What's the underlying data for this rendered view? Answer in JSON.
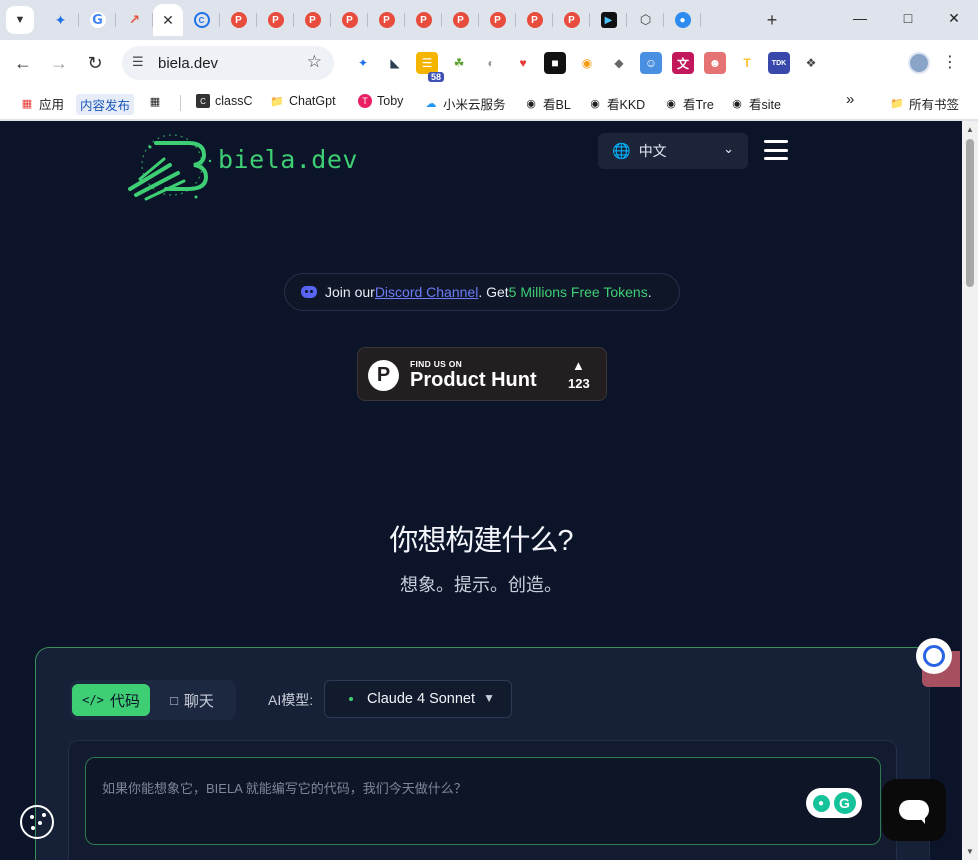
{
  "browser": {
    "tabs": [
      {
        "icon": "v-icon",
        "glyph": "✦",
        "cls": "v"
      },
      {
        "icon": "google-icon",
        "glyph": "G",
        "cls": "g"
      },
      {
        "icon": "trend-icon",
        "glyph": "↗",
        "cls": "trend"
      },
      {
        "icon": "close-icon",
        "glyph": "✕",
        "cls": "x",
        "active": true
      },
      {
        "icon": "c-icon",
        "glyph": "C",
        "cls": "c"
      },
      {
        "icon": "product-hunt-icon",
        "glyph": "P",
        "cls": "p"
      },
      {
        "icon": "product-hunt-icon",
        "glyph": "P",
        "cls": "p"
      },
      {
        "icon": "product-hunt-icon",
        "glyph": "P",
        "cls": "p"
      },
      {
        "icon": "product-hunt-icon",
        "glyph": "P",
        "cls": "p"
      },
      {
        "icon": "product-hunt-icon",
        "glyph": "P",
        "cls": "p"
      },
      {
        "icon": "product-hunt-icon",
        "glyph": "P",
        "cls": "p"
      },
      {
        "icon": "product-hunt-icon",
        "glyph": "P",
        "cls": "p"
      },
      {
        "icon": "product-hunt-icon",
        "glyph": "P",
        "cls": "p"
      },
      {
        "icon": "product-hunt-icon",
        "glyph": "P",
        "cls": "p"
      },
      {
        "icon": "product-hunt-icon",
        "glyph": "P",
        "cls": "p"
      },
      {
        "icon": "arrow-icon",
        "glyph": "▶",
        "cls": "arrow"
      },
      {
        "icon": "cube-icon",
        "glyph": "⬡",
        "cls": "cube"
      },
      {
        "icon": "globe-icon",
        "glyph": "●",
        "cls": "globe"
      }
    ],
    "url": "biela.dev",
    "extensions": [
      {
        "icon": "v-extension-icon",
        "bg": "#ffffff",
        "fg": "#1e73e8",
        "glyph": "✦"
      },
      {
        "icon": "reader-extension-icon",
        "bg": "#ffffff",
        "fg": "#2c3e50",
        "glyph": "◣"
      },
      {
        "icon": "58-extension-icon",
        "bg": "#f5b400",
        "fg": "#fff",
        "glyph": "☰",
        "badge": "58"
      },
      {
        "icon": "puzzle-green-extension-icon",
        "bg": "#ffffff",
        "fg": "#5aa02c",
        "glyph": "☘"
      },
      {
        "icon": "gray-circle-extension-icon",
        "bg": "#ffffff",
        "fg": "#999",
        "glyph": "◐"
      },
      {
        "icon": "red-extension-icon",
        "bg": "#ffffff",
        "fg": "#e53935",
        "glyph": "♥"
      },
      {
        "icon": "dark-extension-icon",
        "bg": "#111111",
        "fg": "#fff",
        "glyph": "■"
      },
      {
        "icon": "orange-extension-icon",
        "bg": "#ffffff",
        "fg": "#f39c12",
        "glyph": "◉"
      },
      {
        "icon": "diamond-extension-icon",
        "bg": "#ffffff",
        "fg": "#666",
        "glyph": "◆"
      },
      {
        "icon": "blue-chat-extension-icon",
        "bg": "#4a90e2",
        "fg": "#fff",
        "glyph": "☺"
      },
      {
        "icon": "translate-extension-icon",
        "bg": "#c2185b",
        "fg": "#fff",
        "glyph": "文"
      },
      {
        "icon": "face-extension-icon",
        "bg": "#e57373",
        "fg": "#fff",
        "glyph": "☻"
      },
      {
        "icon": "t-extension-icon",
        "bg": "#ffffff",
        "fg": "#fbc02d",
        "glyph": "T"
      },
      {
        "icon": "tdk-extension-icon",
        "bg": "#3949ab",
        "fg": "#fff",
        "glyph": "TDK"
      },
      {
        "icon": "puzzle-extension-icon",
        "bg": "#ffffff",
        "fg": "#444",
        "glyph": "❖"
      }
    ],
    "bookmarks": {
      "apps": "应用",
      "publish": "内容发布",
      "classc": "classC",
      "chatgpt": "ChatGpt",
      "toby": "Toby",
      "xiaomi": "小米云服务",
      "bl": "看BL",
      "kkd": "看KKD",
      "tre": "看Tre",
      "site": "看site",
      "more": "»",
      "all": "所有书签"
    }
  },
  "page": {
    "logo_text": "biela.dev",
    "language": "中文",
    "discord": {
      "prefix": "Join our ",
      "link": "Discord Channel",
      "mid": ". Get ",
      "highlight": "5 Millions Free Tokens",
      "suffix": "."
    },
    "product_hunt": {
      "small": "FIND US ON",
      "big": "Product Hunt",
      "count": "123"
    },
    "hero_title": "你想构建什么?",
    "hero_subtitle": "想象。提示。创造。",
    "mode_code": "代码",
    "mode_chat": "聊天",
    "model_label": "AI模型:",
    "model_value": "Claude 4 Sonnet",
    "prompt_placeholder": "如果你能想象它，BIELA 就能编写它的代码，我们今天做什么？"
  },
  "colors": {
    "page_bg": "#0b1428",
    "accent_green": "#3ecf74",
    "discord_blue": "#5865f2",
    "product_hunt_bg": "#231f20"
  }
}
